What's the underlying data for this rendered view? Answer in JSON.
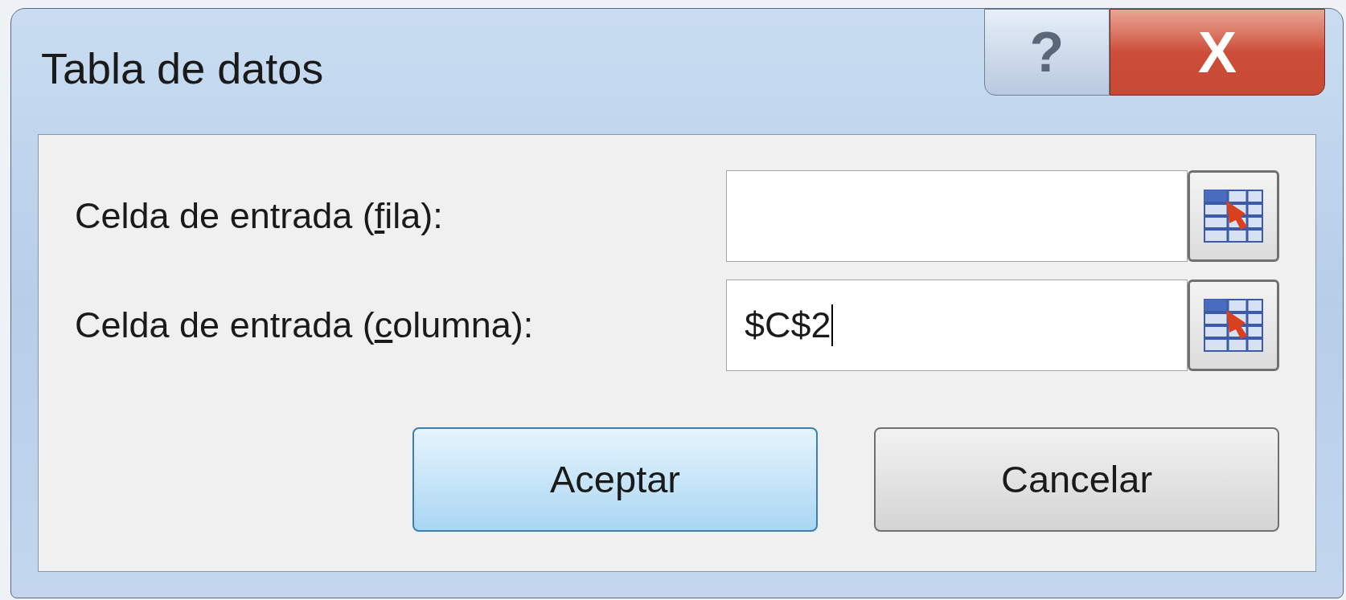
{
  "window": {
    "title": "Tabla de datos",
    "help_button": "?",
    "close_button": "X"
  },
  "fields": [
    {
      "label_before": "Celda de entrada (",
      "access_key": "f",
      "label_after": "ila):"
    },
    {
      "label_before": "Celda de entrada (",
      "access_key": "c",
      "label_after": "olumna):",
      "value": "$C$2",
      "focused": true
    }
  ],
  "buttons": [
    {
      "label": "Aceptar",
      "default": true
    },
    {
      "label": "Cancelar",
      "default": false
    }
  ]
}
